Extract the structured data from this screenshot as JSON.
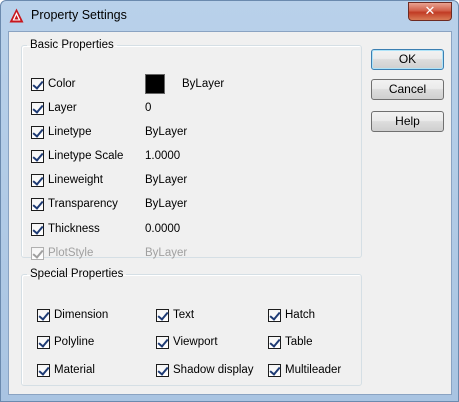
{
  "window": {
    "title": "Property Settings",
    "close_glyph": "✕"
  },
  "basic": {
    "legend": "Basic Properties",
    "rows": [
      {
        "label": "Color",
        "value": "ByLayer",
        "checked": true,
        "enabled": true,
        "swatch_color": "#000000"
      },
      {
        "label": "Layer",
        "value": "0",
        "checked": true,
        "enabled": true
      },
      {
        "label": "Linetype",
        "value": "ByLayer",
        "checked": true,
        "enabled": true
      },
      {
        "label": "Linetype Scale",
        "value": "1.0000",
        "checked": true,
        "enabled": true
      },
      {
        "label": "Lineweight",
        "value": "ByLayer",
        "checked": true,
        "enabled": true
      },
      {
        "label": "Transparency",
        "value": "ByLayer",
        "checked": true,
        "enabled": true
      },
      {
        "label": "Thickness",
        "value": "0.0000",
        "checked": true,
        "enabled": true
      },
      {
        "label": "PlotStyle",
        "value": "ByLayer",
        "checked": true,
        "enabled": false
      }
    ]
  },
  "special": {
    "legend": "Special Properties",
    "items": [
      {
        "label": "Dimension",
        "checked": true
      },
      {
        "label": "Text",
        "checked": true
      },
      {
        "label": "Hatch",
        "checked": true
      },
      {
        "label": "Polyline",
        "checked": true
      },
      {
        "label": "Viewport",
        "checked": true
      },
      {
        "label": "Table",
        "checked": true
      },
      {
        "label": "Material",
        "checked": true
      },
      {
        "label": "Shadow display",
        "checked": true
      },
      {
        "label": "Multileader",
        "checked": true
      }
    ]
  },
  "buttons": {
    "ok": "OK",
    "cancel": "Cancel",
    "help": "Help"
  },
  "colors": {
    "title_bar": "#b9d1ea",
    "dialog_bg": "#f0f0f0",
    "close_button": "#c13b24"
  },
  "icons": {
    "app": "autocad-a-icon",
    "close": "close-icon"
  }
}
